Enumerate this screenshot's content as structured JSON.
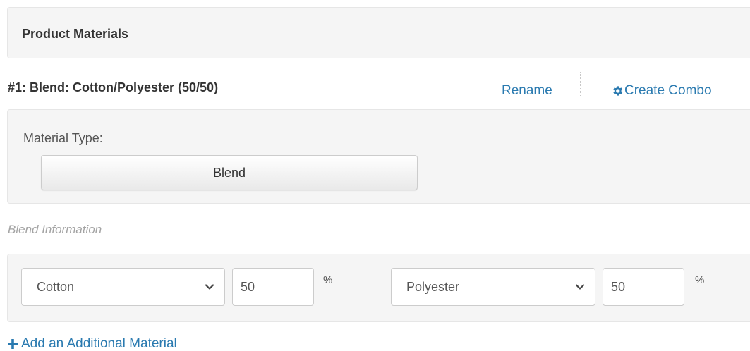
{
  "section": {
    "title": "Product Materials"
  },
  "material": {
    "heading": "#1:  Blend: Cotton/Polyester (50/50)",
    "rename_label": "Rename",
    "create_combo_label": "Create Combo"
  },
  "type_panel": {
    "label": "Material Type:",
    "selected_type": "Blend"
  },
  "blend": {
    "heading": "Blend Information",
    "components": [
      {
        "fiber": "Cotton",
        "percent": "50",
        "unit": "%"
      },
      {
        "fiber": "Polyester",
        "percent": "50",
        "unit": "%"
      }
    ]
  },
  "footer": {
    "add_material_label": "Add an Additional Material"
  },
  "colors": {
    "link": "#2a7ab0",
    "panel_bg": "#f5f5f5",
    "panel_border": "#e6e6e6",
    "muted_text": "#a3a3a3"
  },
  "icons": {
    "combo": "gear-icon",
    "select": "chevron-down-icon",
    "add": "plus-icon"
  }
}
